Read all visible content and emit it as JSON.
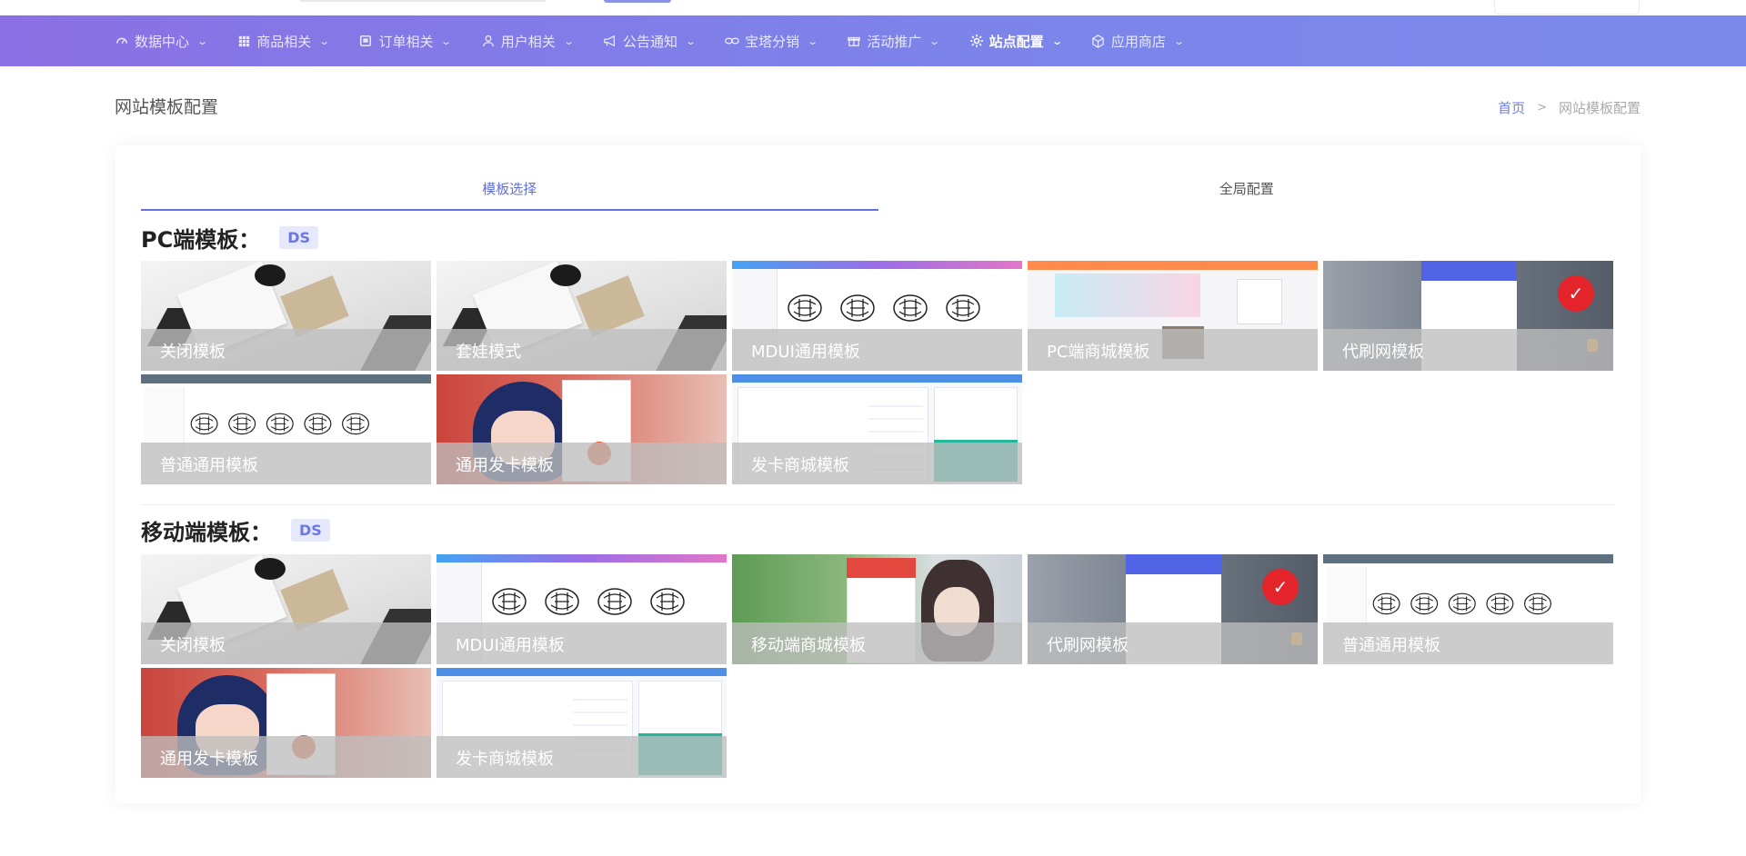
{
  "nav": {
    "items": [
      {
        "label": "数据中心",
        "icon": "dashboard-icon"
      },
      {
        "label": "商品相关",
        "icon": "grid-icon"
      },
      {
        "label": "订单相关",
        "icon": "order-icon"
      },
      {
        "label": "用户相关",
        "icon": "user-icon"
      },
      {
        "label": "公告通知",
        "icon": "megaphone-icon"
      },
      {
        "label": "宝塔分销",
        "icon": "link-icon"
      },
      {
        "label": "活动推广",
        "icon": "gift-icon"
      },
      {
        "label": "站点配置",
        "icon": "gear-icon",
        "active": true
      },
      {
        "label": "应用商店",
        "icon": "cube-icon"
      }
    ],
    "gradient_start": "#8a70e4",
    "gradient_end": "#7b8aea"
  },
  "page": {
    "title": "网站模板配置",
    "breadcrumb": {
      "home": "首页",
      "separator": ">",
      "current": "网站模板配置"
    }
  },
  "tabs": [
    {
      "label": "模板选择",
      "active": true
    },
    {
      "label": "全局配置",
      "active": false
    }
  ],
  "pc_section": {
    "title": "PC端模板：",
    "badge": "DS",
    "templates": [
      {
        "label": "关闭模板",
        "thumb": "paper"
      },
      {
        "label": "套娃模式",
        "thumb": "paper"
      },
      {
        "label": "MDUI通用模板",
        "thumb": "mdui"
      },
      {
        "label": "PC端商城模板",
        "thumb": "shop"
      },
      {
        "label": "代刷网模板",
        "thumb": "daishua"
      },
      {
        "label": "普通通用模板",
        "thumb": "plain"
      },
      {
        "label": "通用发卡模板",
        "thumb": "anime"
      },
      {
        "label": "发卡商城模板",
        "thumb": "faka"
      }
    ]
  },
  "mobile_section": {
    "title": "移动端模板：",
    "badge": "DS",
    "templates": [
      {
        "label": "关闭模板",
        "thumb": "paper"
      },
      {
        "label": "MDUI通用模板",
        "thumb": "mdui"
      },
      {
        "label": "移动端商城模板",
        "thumb": "green"
      },
      {
        "label": "代刷网模板",
        "thumb": "daishua"
      },
      {
        "label": "普通通用模板",
        "thumb": "plain"
      },
      {
        "label": "通用发卡模板",
        "thumb": "anime"
      },
      {
        "label": "发卡商城模板",
        "thumb": "faka"
      }
    ]
  },
  "colors": {
    "accent": "#6270e0",
    "badge_bg": "#e6e8fc",
    "caption_overlay": "rgba(190,190,190,0.78)"
  }
}
